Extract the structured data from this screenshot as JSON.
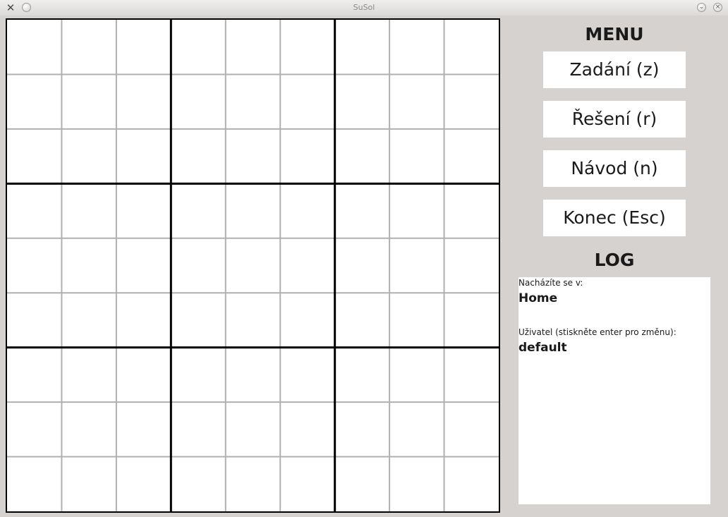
{
  "window": {
    "title": "SuSol",
    "app_icon": "tools-icon",
    "minimize_icon": "circle-icon",
    "shade_icon": "chevron-down-icon",
    "close_icon": "close-icon"
  },
  "board": {
    "rows": 9,
    "cols": 9,
    "cells": [
      [
        "",
        "",
        "",
        "",
        "",
        "",
        "",
        "",
        ""
      ],
      [
        "",
        "",
        "",
        "",
        "",
        "",
        "",
        "",
        ""
      ],
      [
        "",
        "",
        "",
        "",
        "",
        "",
        "",
        "",
        ""
      ],
      [
        "",
        "",
        "",
        "",
        "",
        "",
        "",
        "",
        ""
      ],
      [
        "",
        "",
        "",
        "",
        "",
        "",
        "",
        "",
        ""
      ],
      [
        "",
        "",
        "",
        "",
        "",
        "",
        "",
        "",
        ""
      ],
      [
        "",
        "",
        "",
        "",
        "",
        "",
        "",
        "",
        ""
      ],
      [
        "",
        "",
        "",
        "",
        "",
        "",
        "",
        "",
        ""
      ],
      [
        "",
        "",
        "",
        "",
        "",
        "",
        "",
        "",
        ""
      ]
    ],
    "thin_line_color": "#b0b0b0",
    "thick_line_color": "#000000"
  },
  "menu": {
    "heading": "MENU",
    "buttons": {
      "zadani": "Zadání (z)",
      "reseni": "Řešení (r)",
      "navod": "Návod (n)",
      "konec": "Konec (Esc)"
    }
  },
  "log": {
    "heading": "LOG",
    "location_label": "Nacházíte se v:",
    "location_value": "Home",
    "user_label": "Uživatel (stiskněte enter pro změnu):",
    "user_value": "default"
  }
}
